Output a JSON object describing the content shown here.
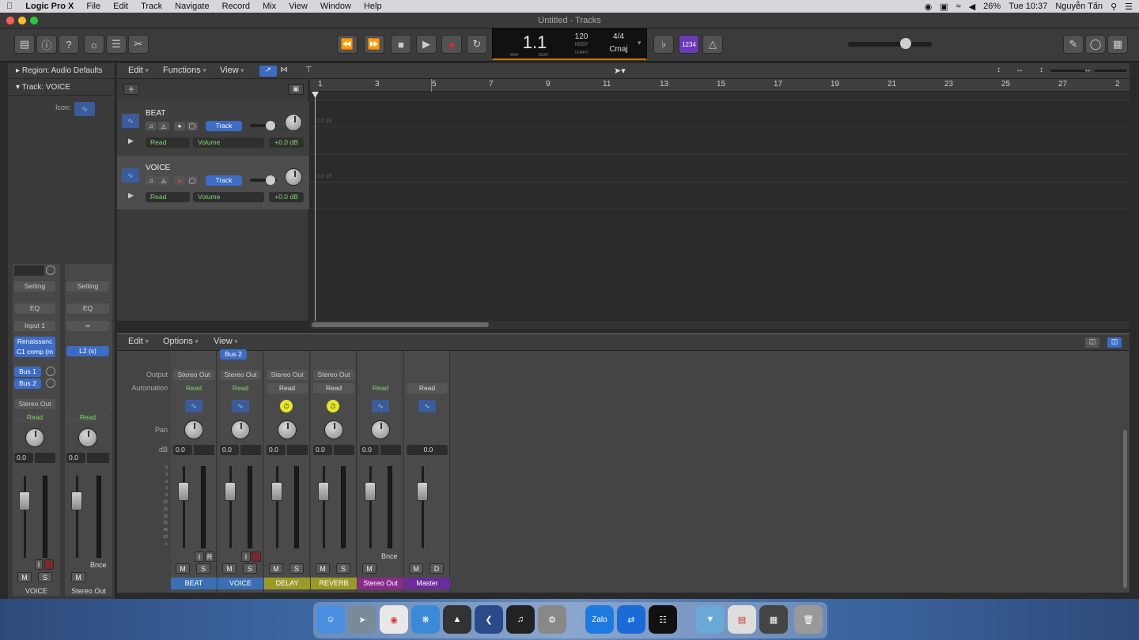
{
  "menubar": {
    "apple": "",
    "app": "Logic Pro X",
    "items": [
      "File",
      "Edit",
      "Track",
      "Navigate",
      "Record",
      "Mix",
      "View",
      "Window",
      "Help"
    ],
    "battery": "26%",
    "clock": "Tue 10:37",
    "user": "Nguyễn Tấn"
  },
  "window": {
    "title": "Untitled - Tracks"
  },
  "lcd": {
    "position": "1.1",
    "bar": "BAR",
    "beat": "BEAT",
    "tempo": "120",
    "keep": "KEEP",
    "tempo_label": "TEMPO",
    "signature": "4/4",
    "key": "Cmaj"
  },
  "toolbar": {
    "count_in": "1234"
  },
  "inspector": {
    "region": "Region: Audio Defaults",
    "track": "Track:  VOICE",
    "icon_label": "Icon:",
    "left": {
      "setting": "Setting",
      "eq": "EQ",
      "input": "Input 1",
      "plugin": "Renaissanc C1 comp (m",
      "bus1": "Bus 1",
      "bus2": "Bus 2",
      "output": "Stereo Out",
      "auto": "Read",
      "db": "0.0",
      "m": "M",
      "s": "S",
      "i": "I",
      "name": "VOICE"
    },
    "right": {
      "setting": "Setting",
      "eq": "EQ",
      "input": "∞",
      "plugin": "L2 (s)",
      "auto": "Read",
      "db": "0.0",
      "m": "M",
      "bnce": "Bnce",
      "name": "Stereo Out"
    }
  },
  "tracks_menu": {
    "edit": "Edit",
    "functions": "Functions",
    "view": "View"
  },
  "ruler": [
    "1",
    "3",
    "5",
    "7",
    "9",
    "11",
    "13",
    "15",
    "17",
    "19",
    "21",
    "23",
    "25",
    "27",
    "2"
  ],
  "tracks": [
    {
      "name": "BEAT",
      "mode": "Track",
      "automation": "Read",
      "param": "Volume",
      "value": "+0.0 dB"
    },
    {
      "name": "VOICE",
      "mode": "Track",
      "automation": "Read",
      "param": "Volume",
      "value": "+0.0 dB"
    }
  ],
  "lane_db": "0.0 dB",
  "mixer_menu": {
    "edit": "Edit",
    "options": "Options",
    "view": "View"
  },
  "mixer_rows": {
    "output": "Output",
    "automation": "Automation",
    "pan": "Pan",
    "db": "dB"
  },
  "channels": [
    {
      "name": "BEAT",
      "output": "Stereo Out",
      "auto": "Read",
      "db": "0.0",
      "m": "M",
      "s": "S",
      "color": "#3a6fb3"
    },
    {
      "name": "VOICE",
      "output": "Stereo Out",
      "auto": "Read",
      "db": "0.0",
      "m": "M",
      "s": "S",
      "color": "#3a6fb3"
    },
    {
      "name": "DELAY",
      "output": "Stereo Out",
      "auto": "Read",
      "db": "0.0",
      "m": "M",
      "s": "S",
      "color": "#9a9a28"
    },
    {
      "name": "REVERB",
      "output": "Stereo Out",
      "auto": "Read",
      "db": "0.0",
      "m": "M",
      "s": "S",
      "color": "#9a9a28"
    },
    {
      "name": "Stereo Out",
      "output": "",
      "auto": "Read",
      "db": "0.0",
      "m": "M",
      "s": "",
      "color": "#8a2b8a"
    },
    {
      "name": "Master",
      "output": "",
      "auto": "Read",
      "db": "0.0",
      "m": "M",
      "s": "D",
      "color": "#6b2b9a"
    }
  ],
  "mixer_extra": {
    "bus2": "Bus 2",
    "beat_i": "I",
    "beat_r": "R",
    "voice_i": "I",
    "bnce": "Bnce"
  },
  "dock": {
    "zalo": "Zalo"
  }
}
